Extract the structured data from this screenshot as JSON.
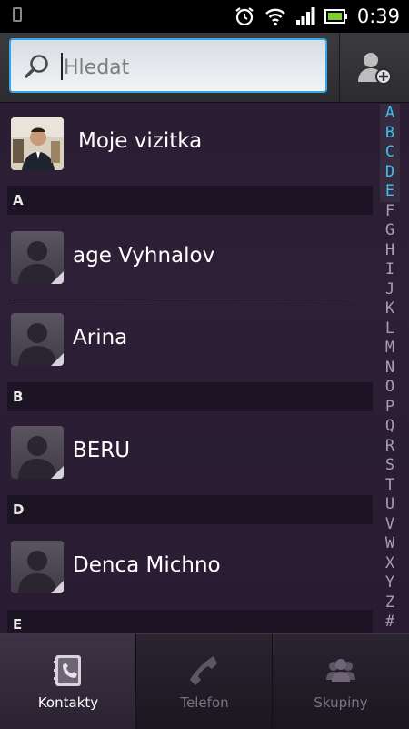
{
  "status_bar": {
    "time": "0:39",
    "icons": [
      "alarm-icon",
      "wifi-icon",
      "signal-icon",
      "battery-icon"
    ]
  },
  "search": {
    "placeholder": "Hledat"
  },
  "my_card": {
    "label": "Moje vizitka"
  },
  "sections": [
    {
      "letter": "A",
      "contacts": [
        "age Vyhnalov",
        "Arina"
      ]
    },
    {
      "letter": "B",
      "contacts": [
        "BERU"
      ]
    },
    {
      "letter": "D",
      "contacts": [
        "Denca Michno"
      ]
    },
    {
      "letter": "E",
      "contacts": []
    }
  ],
  "alphabet_index": {
    "letters": [
      "A",
      "B",
      "C",
      "D",
      "E",
      "F",
      "G",
      "H",
      "I",
      "J",
      "K",
      "L",
      "M",
      "N",
      "O",
      "P",
      "Q",
      "R",
      "S",
      "T",
      "U",
      "V",
      "W",
      "X",
      "Y",
      "Z",
      "#"
    ],
    "highlighted": [
      "A",
      "B",
      "C",
      "D",
      "E"
    ],
    "accent_color": "#3ec0f0"
  },
  "tabs": [
    {
      "label": "Kontakty",
      "icon": "contacts-book-icon",
      "active": true
    },
    {
      "label": "Telefon",
      "icon": "phone-handset-icon",
      "active": false
    },
    {
      "label": "Skupiny",
      "icon": "group-icon",
      "active": false
    }
  ],
  "colors": {
    "accent": "#35a8e6",
    "background": "#2a1d33"
  }
}
